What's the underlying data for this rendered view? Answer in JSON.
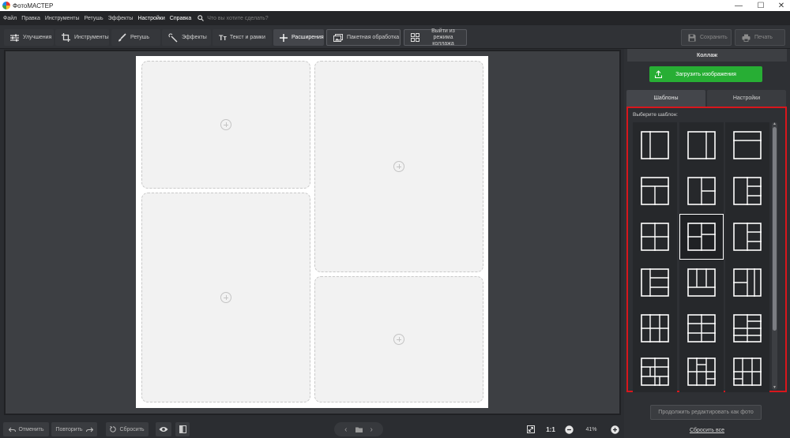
{
  "window": {
    "title": "ФотоМАСТЕР"
  },
  "menu": {
    "items": [
      "Файл",
      "Правка",
      "Инструменты",
      "Ретушь",
      "Эффекты",
      "Настройки",
      "Справка"
    ],
    "search_placeholder": "Что вы хотите сделать?"
  },
  "toolbar": {
    "enhance": "Улучшения",
    "tools": "Инструменты",
    "retouch": "Ретушь",
    "effects": "Эффекты",
    "text": "Текст и рамки",
    "extensions": "Расширения",
    "batch": "Пакетная обработка",
    "exit_collage": "Выйти из режима коллажа",
    "save": "Сохранить",
    "print": "Печать"
  },
  "bottom": {
    "undo": "Отменить",
    "redo": "Повторить",
    "reset": "Сбросить",
    "ratio": "1:1",
    "zoom": "41%"
  },
  "panel": {
    "title": "Коллаж",
    "upload": "Загрузить изображения",
    "tab_templates": "Шаблоны",
    "tab_settings": "Настройки",
    "choose_label": "Выберите шаблон:",
    "continue": "Продолжить редактировать как фото",
    "reset_all": "Сбросить все",
    "selected_template": 7
  },
  "colors": {
    "accent_green": "#27ae34",
    "highlight_red": "#d8161c"
  }
}
